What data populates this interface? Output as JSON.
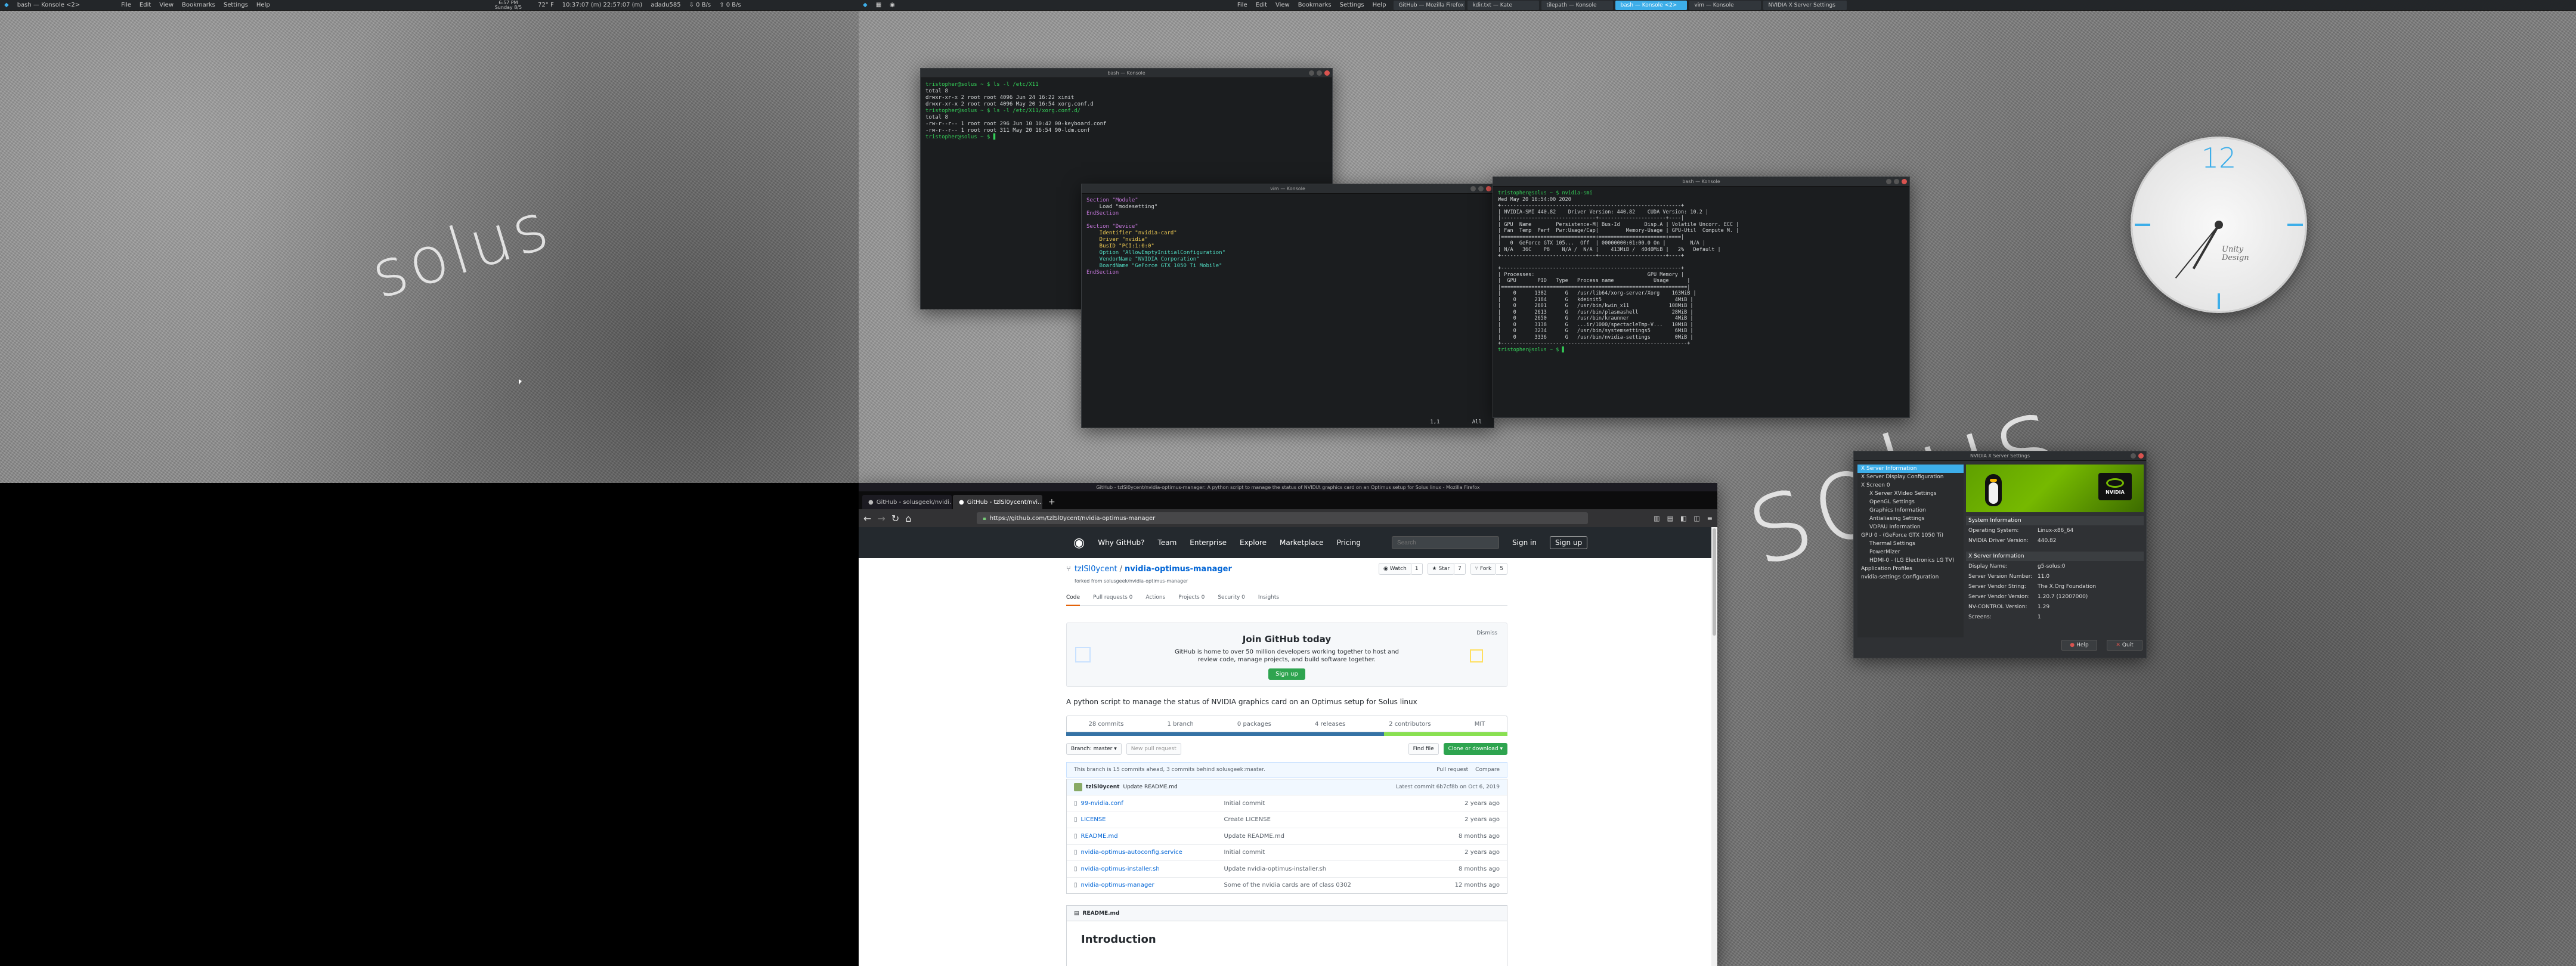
{
  "left_screen": {
    "panel": {
      "app_menu": "bash — Konsole <2>",
      "menus": [
        "File",
        "Edit",
        "View",
        "Bookmarks",
        "Settings",
        "Help"
      ],
      "clock_time": "6:57 PM",
      "clock_date": "Sunday 8/5",
      "status_a": "10:37:07 (m) 22:57:07 (m)",
      "weather": "72° F",
      "host": "adadu585",
      "net_down": "0 B/s",
      "net_up": "0 B/s"
    },
    "wallpaper_logo": "solus"
  },
  "right_screen": {
    "panel": {
      "menus": [
        "File",
        "Edit",
        "View",
        "Bookmarks",
        "Settings",
        "Help"
      ],
      "tasks": [
        "GitHub — Mozilla Firefox",
        "kdir.txt — Kate",
        "tilepath — Konsole",
        "bash — Konsole <2>",
        "vim — Konsole",
        "NVIDIA X Server Settings"
      ]
    },
    "wallpaper_logo": "solus",
    "clock": {
      "number": "12",
      "brand_line1": "Unity",
      "brand_line2": "Design"
    }
  },
  "terminals": {
    "term1": {
      "title": "bash — Konsole",
      "lines": [
        {
          "cls": "g",
          "text": "tristopher@solus ~ $ ls -l /etc/X11"
        },
        {
          "cls": "",
          "text": "total 8"
        },
        {
          "cls": "",
          "text": "drwxr-xr-x 2 root root 4096 Jun 24 16:22 xinit"
        },
        {
          "cls": "",
          "text": "drwxr-xr-x 2 root root 4096 May 20 16:54 xorg.conf.d"
        },
        {
          "cls": "g",
          "text": "tristopher@solus ~ $ ls -l /etc/X11/xorg.conf.d/"
        },
        {
          "cls": "",
          "text": "total 8"
        },
        {
          "cls": "",
          "text": "-rw-r--r-- 1 root root 296 Jun 10 10:42 00-keyboard.conf"
        },
        {
          "cls": "",
          "text": "-rw-r--r-- 1 root root 311 May 20 16:54 90-ldm.conf"
        },
        {
          "cls": "g",
          "text": "tristopher@solus ~ $ ▋"
        }
      ]
    },
    "term2": {
      "title": "vim — Konsole",
      "lines": [
        {
          "cls": "m",
          "text": "Section \"Module\""
        },
        {
          "cls": "",
          "text": "    Load \"modesetting\""
        },
        {
          "cls": "m",
          "text": "EndSection"
        },
        {
          "cls": "",
          "text": ""
        },
        {
          "cls": "m",
          "text": "Section \"Device\""
        },
        {
          "cls": "y",
          "text": "    Identifier \"nvidia-card\""
        },
        {
          "cls": "y",
          "text": "    Driver \"nvidia\""
        },
        {
          "cls": "y",
          "text": "    BusID \"PCI:1:0:0\""
        },
        {
          "cls": "c",
          "text": "    Option \"AllowEmptyInitialConfiguration\""
        },
        {
          "cls": "c",
          "text": "    VendorName \"NVIDIA Corporation\""
        },
        {
          "cls": "c",
          "text": "    BoardName \"GeForce GTX 1050 Ti Mobile\""
        },
        {
          "cls": "m",
          "text": "EndSection"
        }
      ],
      "status": "1,1          All"
    },
    "term3": {
      "title": "bash — Konsole",
      "lines": [
        {
          "cls": "g",
          "text": "tristopher@solus ~ $ nvidia-smi"
        },
        {
          "cls": "",
          "text": "Wed May 20 16:54:00 2020"
        },
        {
          "cls": "",
          "text": "+-----------------------------------------------------------+"
        },
        {
          "cls": "",
          "text": "| NVIDIA-SMI 440.82    Driver Version: 440.82    CUDA Version: 10.2 |"
        },
        {
          "cls": "",
          "text": "|-------------------------------+----------------------+----|"
        },
        {
          "cls": "",
          "text": "| GPU  Name        Persistence-M| Bus-Id        Disp.A | Volatile Uncorr. ECC |"
        },
        {
          "cls": "",
          "text": "| Fan  Temp  Perf  Pwr:Usage/Cap|         Memory-Usage | GPU-Util  Compute M. |"
        },
        {
          "cls": "",
          "text": "|===============================+======================+====|"
        },
        {
          "cls": "",
          "text": "|   0  GeForce GTX 105...  Off  | 00000000:01:00.0 On |        N/A |"
        },
        {
          "cls": "",
          "text": "| N/A   36C    P8    N/A /  N/A |    413MiB /  4040MiB |   2%   Default |"
        },
        {
          "cls": "",
          "text": "+-------------------------------+----------------------+----+"
        },
        {
          "cls": "",
          "text": ""
        },
        {
          "cls": "",
          "text": "+-----------------------------------------------------------+"
        },
        {
          "cls": "",
          "text": "| Processes:                                     GPU Memory |"
        },
        {
          "cls": "",
          "text": "|  GPU       PID   Type   Process name             Usage      |"
        },
        {
          "cls": "",
          "text": "|=============================================================|"
        },
        {
          "cls": "",
          "text": "|    0      1382      G   /usr/lib64/xorg-server/Xorg    163MiB |"
        },
        {
          "cls": "",
          "text": "|    0      2184      G   kdeinit5                        4MiB |"
        },
        {
          "cls": "",
          "text": "|    0      2601      G   /usr/bin/kwin_x11             108MiB |"
        },
        {
          "cls": "",
          "text": "|    0      2613      G   /usr/bin/plasmashell           28MiB |"
        },
        {
          "cls": "",
          "text": "|    0      2650      G   /usr/bin/kraunner               4MiB |"
        },
        {
          "cls": "",
          "text": "|    0      3138      G   ...ir/1000/spectacleTmp-V...   10MiB |"
        },
        {
          "cls": "",
          "text": "|    0      3234      G   /usr/bin/systemsettings5        6MiB |"
        },
        {
          "cls": "",
          "text": "|    0      3336      G   /usr/bin/nvidia-settings        0MiB |"
        },
        {
          "cls": "",
          "text": "+-------------------------------------------------------------+"
        },
        {
          "cls": "g",
          "text": "tristopher@solus ~ $ ▋"
        }
      ]
    }
  },
  "firefox": {
    "title": "GitHub - tzlSl0ycent/nvidia-optimus-manager: A python script to manage the status of NVIDIA graphics card on an Optimus setup for Solus linux - Mozilla Firefox",
    "tabs": [
      "GitHub - solusgeek/nvidi…",
      "GitHub - tzlSl0ycent/nvi…"
    ],
    "url": "https://github.com/tzlSl0ycent/nvidia-optimus-manager",
    "github": {
      "nav": [
        "Why GitHub?",
        "Team",
        "Enterprise",
        "Explore",
        "Marketplace",
        "Pricing"
      ],
      "search_placeholder": "Search",
      "sign_in": "Sign in",
      "sign_up": "Sign up",
      "owner": "tzlSl0ycent",
      "repo": "nvidia-optimus-manager",
      "forked_from": "forked from solusgeek/nvidia-optimus-manager",
      "watch": "Watch",
      "watch_count": "1",
      "star": "Star",
      "star_count": "7",
      "fork": "Fork",
      "fork_count": "5",
      "repo_tabs": [
        "Code",
        "Pull requests 0",
        "Actions",
        "Projects 0",
        "Security 0",
        "Insights"
      ],
      "join_title": "Join GitHub today",
      "join_text": "GitHub is home to over 50 million developers working together to host and review code, manage projects, and build software together.",
      "join_button": "Sign up",
      "dismiss": "Dismiss",
      "description": "A python script to manage the status of NVIDIA graphics card on an Optimus setup for Solus linux",
      "stats": [
        "28 commits",
        "1 branch",
        "0 packages",
        "4 releases",
        "2 contributors",
        "MIT"
      ],
      "branch": "Branch: master ▾",
      "new_pr": "New pull request",
      "find_file": "Find file",
      "clone": "Clone or download ▾",
      "ahead_behind": "This branch is 15 commits ahead, 3 commits behind solusgeek:master.",
      "pull_request": "Pull request",
      "compare": "Compare",
      "latest_author": "tzlSl0ycent",
      "latest_msg": "Update README.md",
      "latest_commit": "Latest commit 6b7cf8b on Oct 6, 2019",
      "files": [
        {
          "name": "99-nvidia.conf",
          "msg": "Initial commit",
          "age": "2 years ago"
        },
        {
          "name": "LICENSE",
          "msg": "Create LICENSE",
          "age": "2 years ago"
        },
        {
          "name": "README.md",
          "msg": "Update README.md",
          "age": "8 months ago"
        },
        {
          "name": "nvidia-optimus-autoconfig.service",
          "msg": "Initial commit",
          "age": "2 years ago"
        },
        {
          "name": "nvidia-optimus-installer.sh",
          "msg": "Update nvidia-optimus-installer.sh",
          "age": "8 months ago"
        },
        {
          "name": "nvidia-optimus-manager",
          "msg": "Some of the nvidia cards are of class 0302",
          "age": "12 months ago"
        }
      ],
      "readme_label": "README.md",
      "readme_heading": "Introduction"
    }
  },
  "nvidia_settings": {
    "title": "NVIDIA X Server Settings",
    "tree": [
      {
        "t": "X Server Information",
        "lvl": 0,
        "sel": true
      },
      {
        "t": "X Server Display Configuration",
        "lvl": 0
      },
      {
        "t": "X Screen 0",
        "lvl": 0
      },
      {
        "t": "X Server XVideo Settings",
        "lvl": 1
      },
      {
        "t": "OpenGL Settings",
        "lvl": 1
      },
      {
        "t": "Graphics Information",
        "lvl": 1
      },
      {
        "t": "Antialiasing Settings",
        "lvl": 1
      },
      {
        "t": "VDPAU Information",
        "lvl": 1
      },
      {
        "t": "GPU 0 - (GeForce GTX 1050 Ti)",
        "lvl": 0
      },
      {
        "t": "Thermal Settings",
        "lvl": 1
      },
      {
        "t": "PowerMizer",
        "lvl": 1
      },
      {
        "t": "HDMI-0 - (LG Electronics LG TV)",
        "lvl": 1
      },
      {
        "t": "Application Profiles",
        "lvl": 0
      },
      {
        "t": "nvidia-settings Configuration",
        "lvl": 0
      }
    ],
    "section_system": "System Information",
    "system_rows": [
      {
        "k": "Operating System:",
        "v": "Linux-x86_64"
      },
      {
        "k": "NVIDIA Driver Version:",
        "v": "440.82"
      }
    ],
    "section_xserver": "X Server Information",
    "xserver_rows": [
      {
        "k": "Display Name:",
        "v": "g5-solus:0"
      },
      {
        "k": "Server Version Number:",
        "v": "11.0"
      },
      {
        "k": "Server Vendor String:",
        "v": "The X.Org Foundation"
      },
      {
        "k": "Server Vendor Version:",
        "v": "1.20.7 (12007000)"
      },
      {
        "k": "NV-CONTROL Version:",
        "v": "1.29"
      },
      {
        "k": "Screens:",
        "v": "1"
      }
    ],
    "help": "Help",
    "quit": "Quit",
    "logo_text": "NVIDIA"
  }
}
